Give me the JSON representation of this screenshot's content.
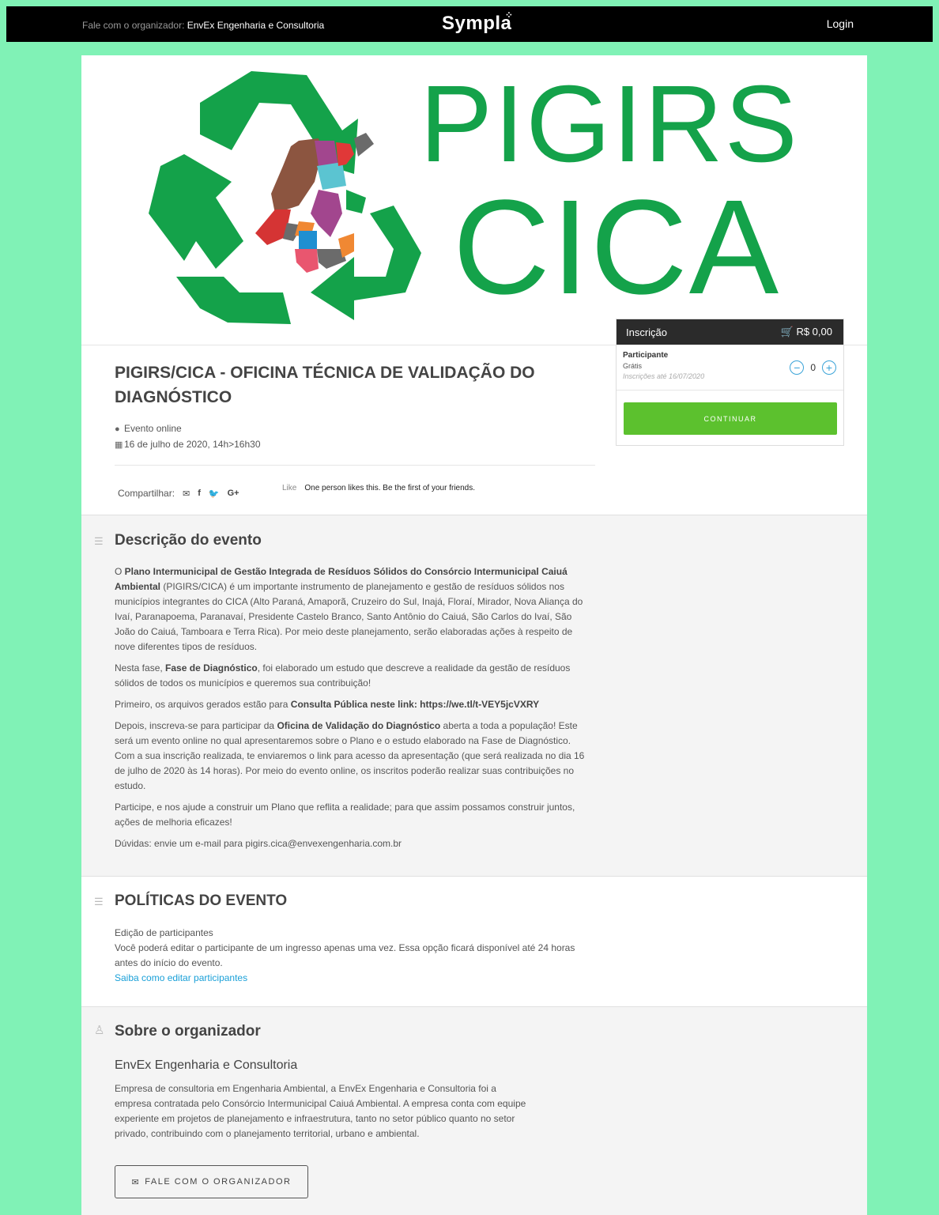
{
  "topbar": {
    "contact_prefix": "Fale com o organizador:",
    "contact_name": "EnvEx Engenharia e Consultoria",
    "brand": "Sympla",
    "login": "Login"
  },
  "banner": {
    "line1": "PIGIRS",
    "line2": "CICA",
    "brand_color": "#14a24a"
  },
  "event": {
    "title": "PIGIRS/CICA - OFICINA TÉCNICA DE VALIDAÇÃO DO DIAGNÓSTICO",
    "location": "Evento online",
    "date": "16 de julho de 2020, 14h>16h30",
    "location_icon": "map-marker-icon",
    "date_icon": "calendar-icon"
  },
  "share": {
    "label": "Compartilhar:",
    "like_label": "Like",
    "like_text": "One person likes this. Be the first of your friends."
  },
  "ticket": {
    "header": "Inscrição",
    "total": "R$ 0,00",
    "type": "Participante",
    "price": "Grátis",
    "deadline": "Inscrições até 16/07/2020",
    "quantity": "0",
    "continue": "CONTINUAR",
    "accent": "#5cc12e"
  },
  "description": {
    "title": "Descrição do evento",
    "p1_b1": "Plano Intermunicipal de Gestão Integrada de Resíduos Sólidos do Consórcio Intermunicipal Caiuá Ambiental",
    "p1_rest": "(PIGIRS/CICA) é um importante instrumento de planejamento e gestão de resíduos sólidos nos municípios integrantes do CICA (Alto Paraná, Amaporã, Cruzeiro do Sul, Inajá, Floraí, Mirador, Nova Aliança do Ivaí, Paranapoema, Paranavaí, Presidente Castelo Branco, Santo Antônio do Caiuá, São Carlos do Ivaí, São João do Caiuá, Tamboara e Terra Rica). Por meio deste planejamento, serão elaboradas ações à respeito de nove diferentes tipos de resíduos.",
    "p2_a": "Nesta fase,",
    "p2_b": "Fase de Diagnóstico",
    "p2_c": ", foi elaborado um estudo que descreve a realidade da gestão de resíduos sólidos de todos os municípios e queremos sua contribuição!",
    "p3_a": "Primeiro, os arquivos gerados estão para",
    "p3_b": "Consulta Pública neste link: https://we.tl/t-VEY5jcVXRY",
    "p4_a": "Depois, inscreva-se para participar da",
    "p4_b": "Oficina de Validação do Diagnóstico",
    "p4_c": "aberta a toda a população! Este será um evento online no qual apresentaremos sobre o Plano e o estudo elaborado na Fase de Diagnóstico. Com a sua inscrição realizada, te enviaremos o link para acesso da apresentação (que será realizada no dia 16 de julho de 2020 às 14 horas). Por meio do evento online, os inscritos poderão realizar suas contribuições no estudo.",
    "p5": "Participe, e nos ajude a construir um Plano que reflita a realidade; para que assim possamos construir juntos, ações de melhoria eficazes!",
    "p6": "Dúvidas: envie um e-mail para pigirs.cica@envexengenharia.com.br"
  },
  "policies": {
    "title": "POLÍTICAS DO EVENTO",
    "subtitle": "Edição de participantes",
    "text": "Você poderá editar o participante de um ingresso apenas uma vez. Essa opção ficará disponível até 24 horas antes do início do evento.",
    "link": "Saiba como editar participantes"
  },
  "organizer": {
    "title": "Sobre o organizador",
    "name": "EnvEx Engenharia e Consultoria",
    "text": "Empresa de consultoria em Engenharia Ambiental, a EnvEx Engenharia e Consultoria foi a empresa contratada pelo Consórcio Intermunicipal Caiuá Ambiental. A empresa conta com equipe experiente em projetos de planejamento e infraestrutura, tanto no setor público quanto no setor privado, contribuindo com o planejamento territorial, urbano e ambiental.",
    "button": "FALE COM O ORGANIZADOR"
  }
}
